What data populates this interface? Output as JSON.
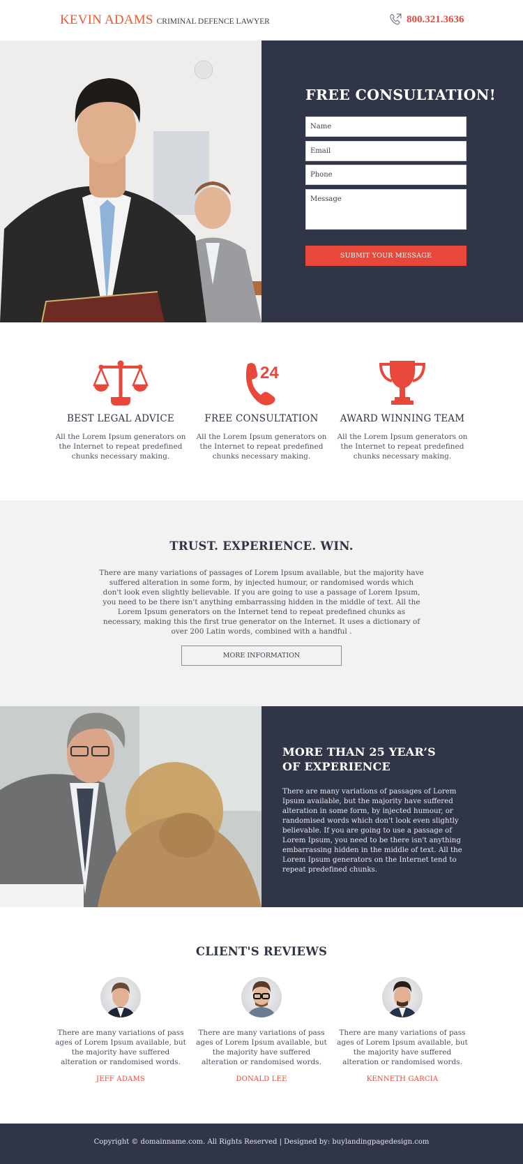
{
  "header": {
    "brand_name": "KEVIN ADAMS",
    "brand_tagline": "CRIMINAL DEFENCE LAWYER",
    "phone_icon": "phone-outgoing-icon",
    "phone_number": "800.321.3636"
  },
  "hero": {
    "photo_alt": "Lawyer in suit holding a folder with colleague in background",
    "form": {
      "title": "FREE CONSULTATION!",
      "fields": {
        "name_placeholder": "Name",
        "email_placeholder": "Email",
        "phone_placeholder": "Phone",
        "message_placeholder": "Message"
      },
      "submit_label": "SUBMIT YOUR MESSAGE"
    }
  },
  "features": [
    {
      "icon": "scales-of-justice-icon",
      "title": "BEST LEGAL ADVICE",
      "text": "All the Lorem Ipsum generators on the Internet to repeat predefined chunks necessary making."
    },
    {
      "icon": "phone-24-hours-icon",
      "badge": "24",
      "title": "FREE CONSULTATION",
      "text": "All the Lorem Ipsum generators on the Internet to repeat predefined chunks necessary making."
    },
    {
      "icon": "trophy-icon",
      "title": "AWARD WINNING TEAM",
      "text": "All the Lorem Ipsum generators on the Internet to repeat predefined chunks necessary making."
    }
  ],
  "trust": {
    "title": "TRUST. EXPERIENCE. WIN.",
    "text": "There are many variations of passages of Lorem Ipsum available, but the majority have suffered alteration in some form, by injected humour, or randomised words which don't look even slightly believable. If you are going to use a passage of Lorem Ipsum, you need to be there isn't anything embarrassing hidden in the middle of text. All the Lorem Ipsum generators on the Internet tend to repeat predefined chunks as necessary, making this the first true generator on the Internet. It uses a dictionary of over 200 Latin words, combined with a handful .",
    "button_label": "MORE INFORMATION"
  },
  "experience": {
    "photo_alt": "Senior lawyer in meeting with client",
    "title_line1": "MORE THAN 25 YEAR’S",
    "title_line2": "OF EXPERIENCE",
    "text": "There are many variations of passages of Lorem Ipsum available, but the majority have suffered alteration in some form, by injected humour, or randomised words which don't look even slightly believable. If you are going to use a passage of Lorem Ipsum, you need to be there isn't anything embarrassing hidden in the middle of text. All the Lorem Ipsum generators on the Internet tend to repeat predefined chunks."
  },
  "reviews": {
    "title": "CLIENT'S REVIEWS",
    "items": [
      {
        "name": "JEFF ADAMS",
        "text": "There are many variations of pass ages of Lorem Ipsum available, but the majority have suffered alteration or randomised words."
      },
      {
        "name": "DONALD LEE",
        "text": "There are many variations of pass ages of Lorem Ipsum available, but the majority have suffered alteration or randomised words."
      },
      {
        "name": "KENNETH GARCIA",
        "text": "There are many variations of pass ages of Lorem Ipsum available, but the majority have suffered alteration or randomised words."
      }
    ]
  },
  "footer": {
    "text": "Copyright © domainname.com. All Rights Reserved  |  Designed by: buylandingpagedesign.com"
  },
  "colors": {
    "accent_red": "#e8483a",
    "brand_orange": "#ef5a2c",
    "navy_panel": "#303648",
    "light_section_bg": "#f3f1f1",
    "heading_text": "#2f3546"
  }
}
